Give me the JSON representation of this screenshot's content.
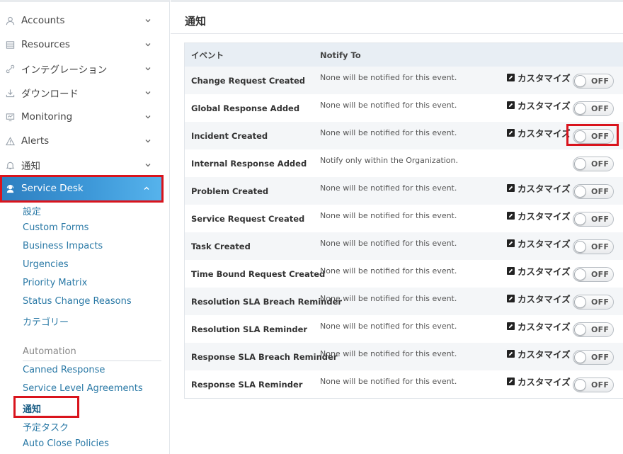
{
  "sidebar": {
    "items": [
      {
        "label": "Accounts",
        "icon": "user-icon"
      },
      {
        "label": "Resources",
        "icon": "resources-icon"
      },
      {
        "label": "インテグレーション",
        "icon": "link-icon"
      },
      {
        "label": "ダウンロード",
        "icon": "download-icon"
      },
      {
        "label": "Monitoring",
        "icon": "monitor-icon"
      },
      {
        "label": "Alerts",
        "icon": "warning-icon"
      },
      {
        "label": "通知",
        "icon": "bell-icon"
      },
      {
        "label": "Service Desk",
        "icon": "headset-icon"
      }
    ],
    "service_desk_sub": [
      "設定",
      "Custom Forms",
      "Business Impacts",
      "Urgencies",
      "Priority Matrix",
      "Status Change Reasons",
      "カテゴリー"
    ],
    "automation_heading": "Automation",
    "automation_sub": [
      "Canned Response",
      "Service Level Agreements",
      "通知",
      "予定タスク",
      "Auto Close Policies"
    ]
  },
  "main": {
    "title": "通知",
    "columns": {
      "event": "イベント",
      "notify_to": "Notify To"
    },
    "customize_label": "カスタマイズ",
    "toggle_label": "OFF",
    "rows": [
      {
        "event": "Change Request Created",
        "notify": "None will be notified for this event.",
        "customize": true
      },
      {
        "event": "Global Response Added",
        "notify": "None will be notified for this event.",
        "customize": true
      },
      {
        "event": "Incident Created",
        "notify": "None will be notified for this event.",
        "customize": true
      },
      {
        "event": "Internal Response Added",
        "notify": "Notify only within the Organization.",
        "customize": false
      },
      {
        "event": "Problem Created",
        "notify": "None will be notified for this event.",
        "customize": true
      },
      {
        "event": "Service Request Created",
        "notify": "None will be notified for this event.",
        "customize": true
      },
      {
        "event": "Task Created",
        "notify": "None will be notified for this event.",
        "customize": true
      },
      {
        "event": "Time Bound Request Created",
        "notify": "None will be notified for this event.",
        "customize": true
      },
      {
        "event": "Resolution SLA Breach Reminder",
        "notify": "None will be notified for this event.",
        "customize": true
      },
      {
        "event": "Resolution SLA Reminder",
        "notify": "None will be notified for this event.",
        "customize": true
      },
      {
        "event": "Response SLA Breach Reminder",
        "notify": "None will be notified for this event.",
        "customize": true
      },
      {
        "event": "Response SLA Reminder",
        "notify": "None will be notified for this event.",
        "customize": true
      }
    ]
  },
  "colors": {
    "accent": "#3d98d8",
    "highlight": "#d9141d",
    "link": "#2a79a6"
  }
}
